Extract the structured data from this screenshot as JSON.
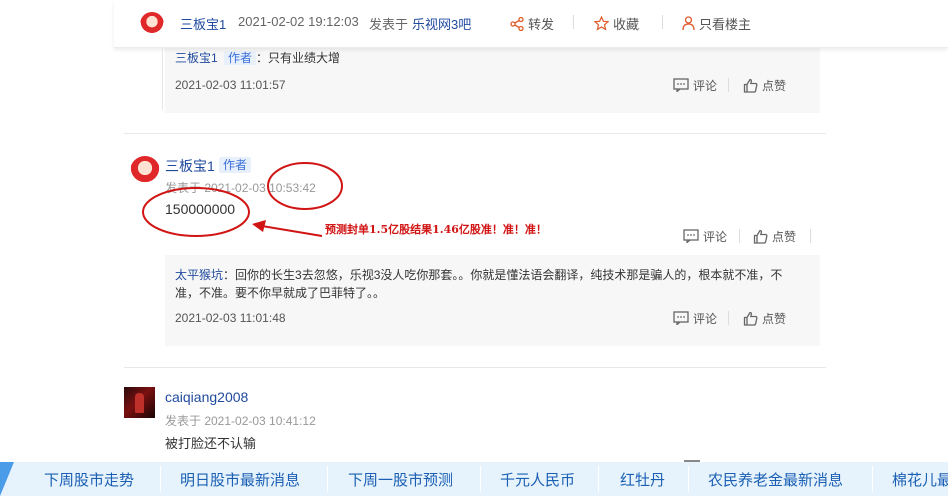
{
  "topbar": {
    "username": "三板宝1",
    "datetime": "2021-02-02 19:12:03",
    "posted_in_prefix": "发表于",
    "forum": "乐视网3吧",
    "share_label": "转发",
    "favorite_label": "收藏",
    "only_op_label": "只看楼主"
  },
  "reply_prev": {
    "user": "三板宝1",
    "author_tag": "作者",
    "text": "：只有业绩大增",
    "date": "2021-02-03 11:01:57",
    "comment_label": "评论",
    "like_label": "点赞"
  },
  "post_main": {
    "username": "三板宝1",
    "author_tag": "作者",
    "meta_prefix": "发表于",
    "date": "2021-02-03",
    "time": "10:53:42",
    "body": "150000000",
    "comment_label": "评论",
    "like_label": "点赞",
    "annotation": "预测封单1.5亿股结果1.46亿股准！准！准！",
    "reply": {
      "user": "太平猴坑",
      "text_line1": "：回你的长生3去忽悠，乐视3没人吃你那套。。你就是懂法语会翻译，纯技术那是骗人的，根本就不准，不",
      "text_line2": "准，不准。要不你早就成了巴菲特了。。",
      "date": "2021-02-03 11:01:48",
      "comment_label": "评论",
      "like_label": "点赞"
    }
  },
  "post_next": {
    "username": "caiqiang2008",
    "meta": "发表于 2021-02-03 10:41:12",
    "body": "被打脸还不认输"
  },
  "tags": [
    "下周股市走势",
    "明日股市最新消息",
    "下周一股市预测",
    "千元人民币",
    "红牡丹",
    "农民养老金最新消息",
    "棉花儿最"
  ],
  "colors": {
    "link_blue": "#1f4a9e",
    "annotation_red": "#d11414",
    "tagbar_bg": "#e6f3fd",
    "topbar_accent": "#e05a2a"
  },
  "icons": [
    "share-icon",
    "star-icon",
    "person-icon",
    "comment-icon",
    "thumb-up-icon"
  ]
}
